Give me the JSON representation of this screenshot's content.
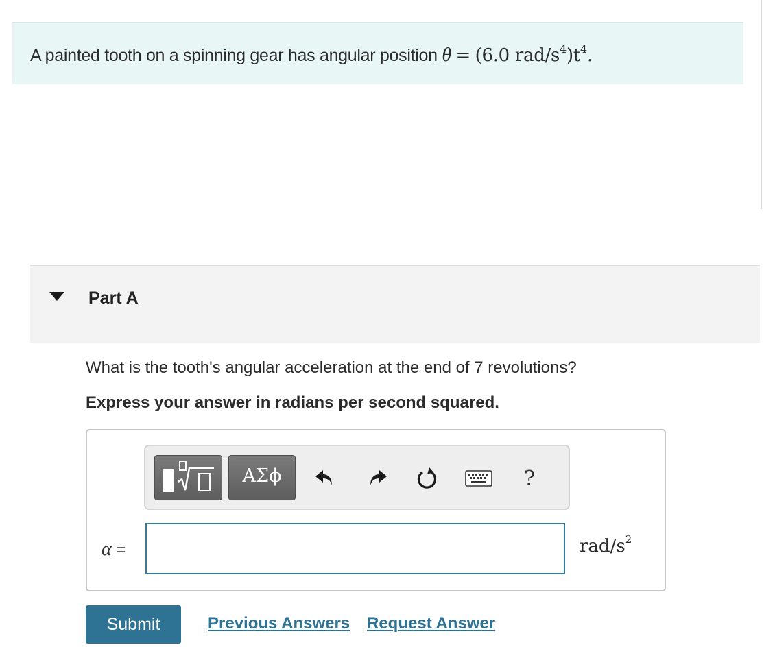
{
  "problem": {
    "text": "A painted tooth on a spinning gear has angular position ",
    "equation": {
      "variable": "θ",
      "equals": "=",
      "coefficient": "(6.0 rad/s",
      "coef_power": "4",
      "close": ")t",
      "t_power": "4",
      "period": "."
    }
  },
  "part": {
    "title": "Part A",
    "toggle_icon": "triangle-down-icon",
    "question": "What is the tooth's angular acceleration at the end of 7 revolutions?",
    "instruction": "Express your answer in radians per second squared."
  },
  "toolbar": {
    "templates_icon": "templates-icon",
    "symbols_label": "ΑΣϕ",
    "undo_icon": "undo-icon",
    "redo_icon": "redo-icon",
    "reset_icon": "reset-icon",
    "keyboard_icon": "keyboard-icon",
    "help_label": "?"
  },
  "answer": {
    "variable": "α",
    "equals": "=",
    "value": "",
    "unit": "rad/s",
    "unit_power": "2"
  },
  "actions": {
    "submit_label": "Submit",
    "previous_answers_label": "Previous Answers",
    "request_answer_label": "Request Answer"
  },
  "colors": {
    "intro_background": "#e8f6f6",
    "part_background": "#f3f3f3",
    "accent": "#2e7394",
    "input_border": "#3c7b98"
  }
}
